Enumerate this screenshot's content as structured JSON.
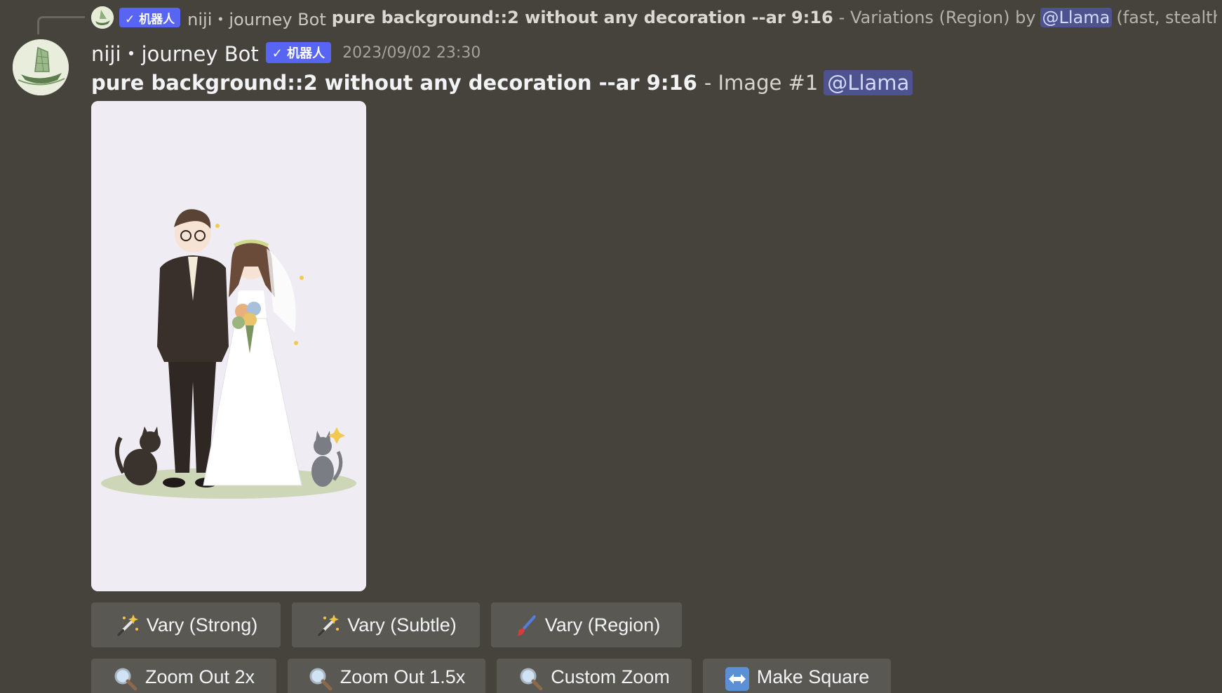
{
  "reply": {
    "author": "niji・journey Bot",
    "badge": "✓ 机器人",
    "prompt": "pure background::2 without any decoration --ar 9:16",
    "action": "- Variations (Region) by",
    "mention": "@Llama",
    "suffix": "(fast, stealth)"
  },
  "message": {
    "author": "niji・journey Bot",
    "badge": "✓ 机器人",
    "timestamp": "2023/09/02 23:30",
    "prompt": "pure background::2 without any decoration --ar 9:16",
    "image_label": "- Image #1",
    "mention": "@Llama"
  },
  "buttons": {
    "row1": [
      {
        "label": "Vary (Strong)",
        "icon": "magic-wand-icon"
      },
      {
        "label": "Vary (Subtle)",
        "icon": "magic-wand-icon"
      },
      {
        "label": "Vary (Region)",
        "icon": "paintbrush-icon"
      }
    ],
    "row2": [
      {
        "label": "Zoom Out 2x",
        "icon": "magnifier-icon"
      },
      {
        "label": "Zoom Out 1.5x",
        "icon": "magnifier-icon"
      },
      {
        "label": "Custom Zoom",
        "icon": "magnifier-icon"
      },
      {
        "label": "Make Square",
        "icon": "left-right-arrow-icon"
      }
    ]
  },
  "colors": {
    "background": "#46423c",
    "badge": "#5865f2",
    "button": "#5a5853",
    "mention": "#5865f2"
  }
}
